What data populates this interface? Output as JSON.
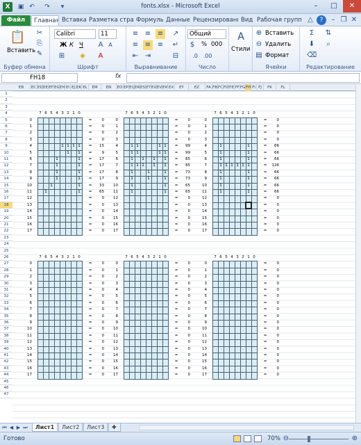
{
  "window": {
    "title": "fonts.xlsx - Microsoft Excel",
    "logo": "X"
  },
  "quick_access": {
    "icons": [
      "save-icon",
      "undo-icon",
      "redo-icon",
      "customize-icon"
    ]
  },
  "ribbon_tabs": [
    "Файл",
    "Главная",
    "Вставка",
    "Разметка страни",
    "Формулы",
    "Данные",
    "Рецензировани",
    "Вид",
    "Рабочая группа"
  ],
  "ribbon": {
    "clipboard": {
      "paste": "Вставить",
      "label": "Буфер обмена"
    },
    "font": {
      "name": "Calibri",
      "size": "11",
      "bold": "Ж",
      "italic": "К",
      "underline": "Ч",
      "label": "Шрифт"
    },
    "alignment": {
      "label": "Выравнивание"
    },
    "number": {
      "format": "Общий",
      "percent": "%",
      "thousands": "000",
      "label": "Число"
    },
    "styles": {
      "label": "Стили"
    },
    "cells": {
      "insert": "Вставить",
      "delete": "Удалить",
      "format": "Формат",
      "label": "Ячейки"
    },
    "editing": {
      "label": "Редактирование"
    }
  },
  "formula_bar": {
    "name_box": "FH18",
    "fx": "fx",
    "formula": ""
  },
  "columns": [
    "EB",
    "EC",
    "ED",
    "EE",
    "EF",
    "EG",
    "EH",
    "EI",
    "EJ",
    "EK",
    "EL",
    "EM",
    "EN",
    "EO",
    "EP",
    "EQ",
    "ER",
    "ES",
    "ET",
    "EU",
    "EV",
    "EW",
    "EX",
    "EY",
    "EZ",
    "FA",
    "FB",
    "FC",
    "FD",
    "FE",
    "FF",
    "FG",
    "FH",
    "FI",
    "FJ",
    "FK",
    "FL"
  ],
  "selected_column": "FH",
  "rows": [
    "1",
    "2",
    "3",
    "4",
    "5",
    "6",
    "7",
    "8",
    "9",
    "10",
    "11",
    "12",
    "13",
    "14",
    "15",
    "16",
    "17",
    "18",
    "19",
    "20",
    "21",
    "22",
    "23",
    "24",
    "25",
    "26",
    "27",
    "28",
    "29",
    "30",
    "31",
    "32",
    "33",
    "34",
    "35",
    "36",
    "37",
    "38",
    "39",
    "40",
    "41",
    "42",
    "43",
    "44",
    "45",
    "46",
    "47"
  ],
  "selected_row": "18",
  "bit_headers": [
    "7",
    "6",
    "5",
    "4",
    "3",
    "2",
    "1",
    "0"
  ],
  "row_labels": [
    "0",
    "1",
    "2",
    "3",
    "4",
    "5",
    "6",
    "7",
    "8",
    "9",
    "10",
    "11",
    "12",
    "13",
    "14",
    "15",
    "16",
    "17"
  ],
  "blocks": [
    {
      "name": "block-top-left",
      "bits": [
        [],
        [],
        [],
        [],
        [
          "3",
          "2",
          "1",
          "0"
        ],
        [
          "2",
          "0"
        ],
        [
          "4",
          "0"
        ],
        [
          "4",
          "0"
        ],
        [
          "4",
          "0"
        ],
        [
          "4",
          "0"
        ],
        [
          "5",
          "0"
        ],
        [
          "6",
          "0"
        ],
        [],
        [],
        [],
        [],
        [],
        []
      ],
      "values": [
        "0",
        "0",
        "0",
        "0",
        "15",
        "9",
        "17",
        "17",
        "17",
        "17",
        "33",
        "65",
        "0",
        "0",
        "0",
        "0",
        "0",
        "0"
      ]
    },
    {
      "name": "block-top-middle",
      "bits": [
        [],
        [],
        [],
        [],
        [
          "6",
          "5",
          "1",
          "0"
        ],
        [
          "6",
          "5",
          "1",
          "0"
        ],
        [
          "6",
          "4",
          "2",
          "0"
        ],
        [
          "6",
          "5",
          "4",
          "2",
          "0"
        ],
        [
          "6",
          "3",
          "0"
        ],
        [
          "6",
          "3",
          "0"
        ],
        [
          "6",
          "0"
        ],
        [
          "6",
          "0"
        ],
        [],
        [],
        [],
        [],
        [],
        []
      ],
      "values": [
        "0",
        "0",
        "0",
        "0",
        "99",
        "99",
        "85",
        "85",
        "73",
        "73",
        "65",
        "65",
        "0",
        "0",
        "0",
        "0",
        "0",
        "0"
      ]
    },
    {
      "name": "block-top-right",
      "bits": [
        [],
        [],
        [],
        [],
        [
          "6",
          "1"
        ],
        [
          "6",
          "1"
        ],
        [
          "6",
          "1"
        ],
        [
          "6",
          "5",
          "4",
          "3",
          "2",
          "1"
        ],
        [
          "6",
          "1"
        ],
        [
          "6",
          "1"
        ],
        [
          "6",
          "1"
        ],
        [
          "6",
          "1"
        ],
        [],
        [],
        [],
        [],
        [],
        []
      ],
      "values": [
        "0",
        "0",
        "0",
        "0",
        "66",
        "66",
        "66",
        "126",
        "66",
        "66",
        "66",
        "66",
        "0",
        "0",
        "0",
        "0",
        "0",
        "0"
      ]
    },
    {
      "name": "block-bottom-left",
      "bits": [
        [],
        [],
        [],
        [],
        [],
        [],
        [],
        [],
        [],
        [],
        [],
        [],
        [],
        [],
        [],
        [],
        [],
        []
      ],
      "values": [
        "0",
        "0",
        "0",
        "0",
        "0",
        "0",
        "0",
        "0",
        "0",
        "0",
        "0",
        "0",
        "0",
        "0",
        "0",
        "0",
        "0",
        "0"
      ]
    },
    {
      "name": "block-bottom-middle",
      "bits": [
        [],
        [],
        [],
        [],
        [],
        [],
        [],
        [],
        [],
        [],
        [],
        [],
        [],
        [],
        [],
        [],
        [],
        []
      ],
      "values": [
        "0",
        "0",
        "0",
        "0",
        "0",
        "0",
        "0",
        "0",
        "0",
        "0",
        "0",
        "0",
        "0",
        "0",
        "0",
        "0",
        "0",
        "0"
      ]
    },
    {
      "name": "block-bottom-right",
      "bits": [
        [],
        [],
        [],
        [],
        [],
        [],
        [],
        [],
        [],
        [],
        [],
        [],
        [],
        [],
        [],
        [],
        [],
        []
      ],
      "values": [
        "0",
        "0",
        "0",
        "0",
        "0",
        "0",
        "0",
        "0",
        "0",
        "0",
        "0",
        "0",
        "0",
        "0",
        "0",
        "0",
        "0",
        "0"
      ]
    }
  ],
  "cell_mark": "1",
  "eq_sign": "=",
  "sheets": [
    "Лист1",
    "Лист2",
    "Лист3"
  ],
  "active_sheet": "Лист1",
  "status": {
    "text": "Готово",
    "zoom": "70%"
  }
}
